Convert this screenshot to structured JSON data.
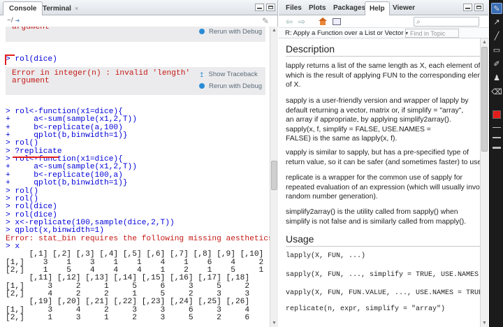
{
  "left_pane": {
    "tabs": [
      "Console",
      "Terminal"
    ],
    "tab_close": "×",
    "path": "~/",
    "error_box_top": {
      "lines": [
        "argument"
      ],
      "action": "Rerun with Debug"
    },
    "error_box_main": {
      "lines": [
        "Error in integer(n) : invalid 'length'",
        "argument"
      ],
      "actions": [
        "Show Traceback",
        "Rerun with Debug"
      ]
    },
    "first_command": "> rol(dice)",
    "lines": [
      {
        "t": "> rol<-function(x1=dice){",
        "c": "blue"
      },
      {
        "t": "+     a<-sum(sample(x1,2,T))",
        "c": "blue"
      },
      {
        "t": "+     b<-replicate(a,100)",
        "c": "blue"
      },
      {
        "t": "+     qplot(b,binwidth=1)}",
        "c": "blue"
      },
      {
        "t": "> rol()",
        "c": "blue"
      },
      {
        "t": "> ?replicate",
        "c": "blue"
      },
      {
        "t": "> rol<-function(x1=dice){",
        "c": "blue"
      },
      {
        "t": "+     a<-sum(sample(x1,2,T))",
        "c": "blue"
      },
      {
        "t": "+     b<-replicate(100,a)",
        "c": "blue"
      },
      {
        "t": "+     qplot(b,binwidth=1)}",
        "c": "blue"
      },
      {
        "t": "> rol()",
        "c": "blue"
      },
      {
        "t": "> rol()",
        "c": "blue"
      },
      {
        "t": "> rol(dice)",
        "c": "blue"
      },
      {
        "t": "> rol(dice)",
        "c": "blue"
      },
      {
        "t": "> x<-replicate(100,sample(dice,2,T))",
        "c": "blue"
      },
      {
        "t": "> qplot(x,binwidth=1)",
        "c": "blue"
      },
      {
        "t": "Error: stat_bin requires the following missing aesthetics: x",
        "c": "red"
      },
      {
        "t": "> x",
        "c": "blue"
      },
      {
        "t": "     [,1] [,2] [,3] [,4] [,5] [,6] [,7] [,8] [,9] [,10]",
        "c": "dark"
      },
      {
        "t": "[1,]    3    1    3    1    1    4    1    6    4     2",
        "c": "dark"
      },
      {
        "t": "[2,]    1    5    4    4    4    1    2    1    5     1",
        "c": "dark"
      },
      {
        "t": "     [,11] [,12] [,13] [,14] [,15] [,16] [,17] [,18]",
        "c": "dark"
      },
      {
        "t": "[1,]     3     2     1     5     6     3     5     2",
        "c": "dark"
      },
      {
        "t": "[2,]     4     2     2     1     5     2     3     3",
        "c": "dark"
      },
      {
        "t": "     [,19] [,20] [,21] [,22] [,23] [,24] [,25] [,26]",
        "c": "dark"
      },
      {
        "t": "[1,]     3     4     2     3     3     6     3     4",
        "c": "dark"
      },
      {
        "t": "[2,]     1     3     1     2     3     5     2     6",
        "c": "dark"
      }
    ]
  },
  "right_pane": {
    "tabs": [
      "Files",
      "Plots",
      "Packages",
      "Help",
      "Viewer"
    ],
    "search_placeholder": "",
    "topic_title": "R: Apply a Function over a List or Vector",
    "topic_caret": "▾",
    "find_in_topic": "Find in Topic",
    "description_heading": "Description",
    "usage_heading": "Usage",
    "paragraphs": [
      [
        "lapply returns a list of the same length as X, each element of",
        "which is the result of applying FUN to the corresponding element",
        "of X."
      ],
      [
        "sapply is a user-friendly version and wrapper of lapply by",
        "default returning a vector, matrix or, if simplify = \"array\",",
        "an array if appropriate, by applying simplify2array().",
        "sapply(x, f, simplify = FALSE, USE.NAMES =",
        "FALSE) is the same as lapply(x, f)."
      ],
      [
        "vapply is similar to sapply, but has a pre-specified type of",
        "return value, so it can be safer (and sometimes faster) to use."
      ],
      [
        "replicate is a wrapper for the common use of sapply for",
        "repeated evaluation of an expression (which will usually involve",
        "random number generation)."
      ],
      [
        "simplify2array() is the utility called from sapply() when",
        "simplify is not false and is similarly called from mapply()."
      ]
    ],
    "usage_lines": [
      "lapply(X, FUN, ...)",
      "sapply(X, FUN, ..., simplify = TRUE, USE.NAMES =",
      "vapply(X, FUN, FUN.VALUE, ..., USE.NAMES = TRUE)",
      "replicate(n, expr, simplify = \"array\")"
    ]
  },
  "annotation_toolbar": {
    "tools": [
      "pen-icon",
      "arrow-icon",
      "line-icon",
      "shape-icon",
      "text-icon",
      "eraser-icon"
    ],
    "current_color": "#e31c1c"
  }
}
